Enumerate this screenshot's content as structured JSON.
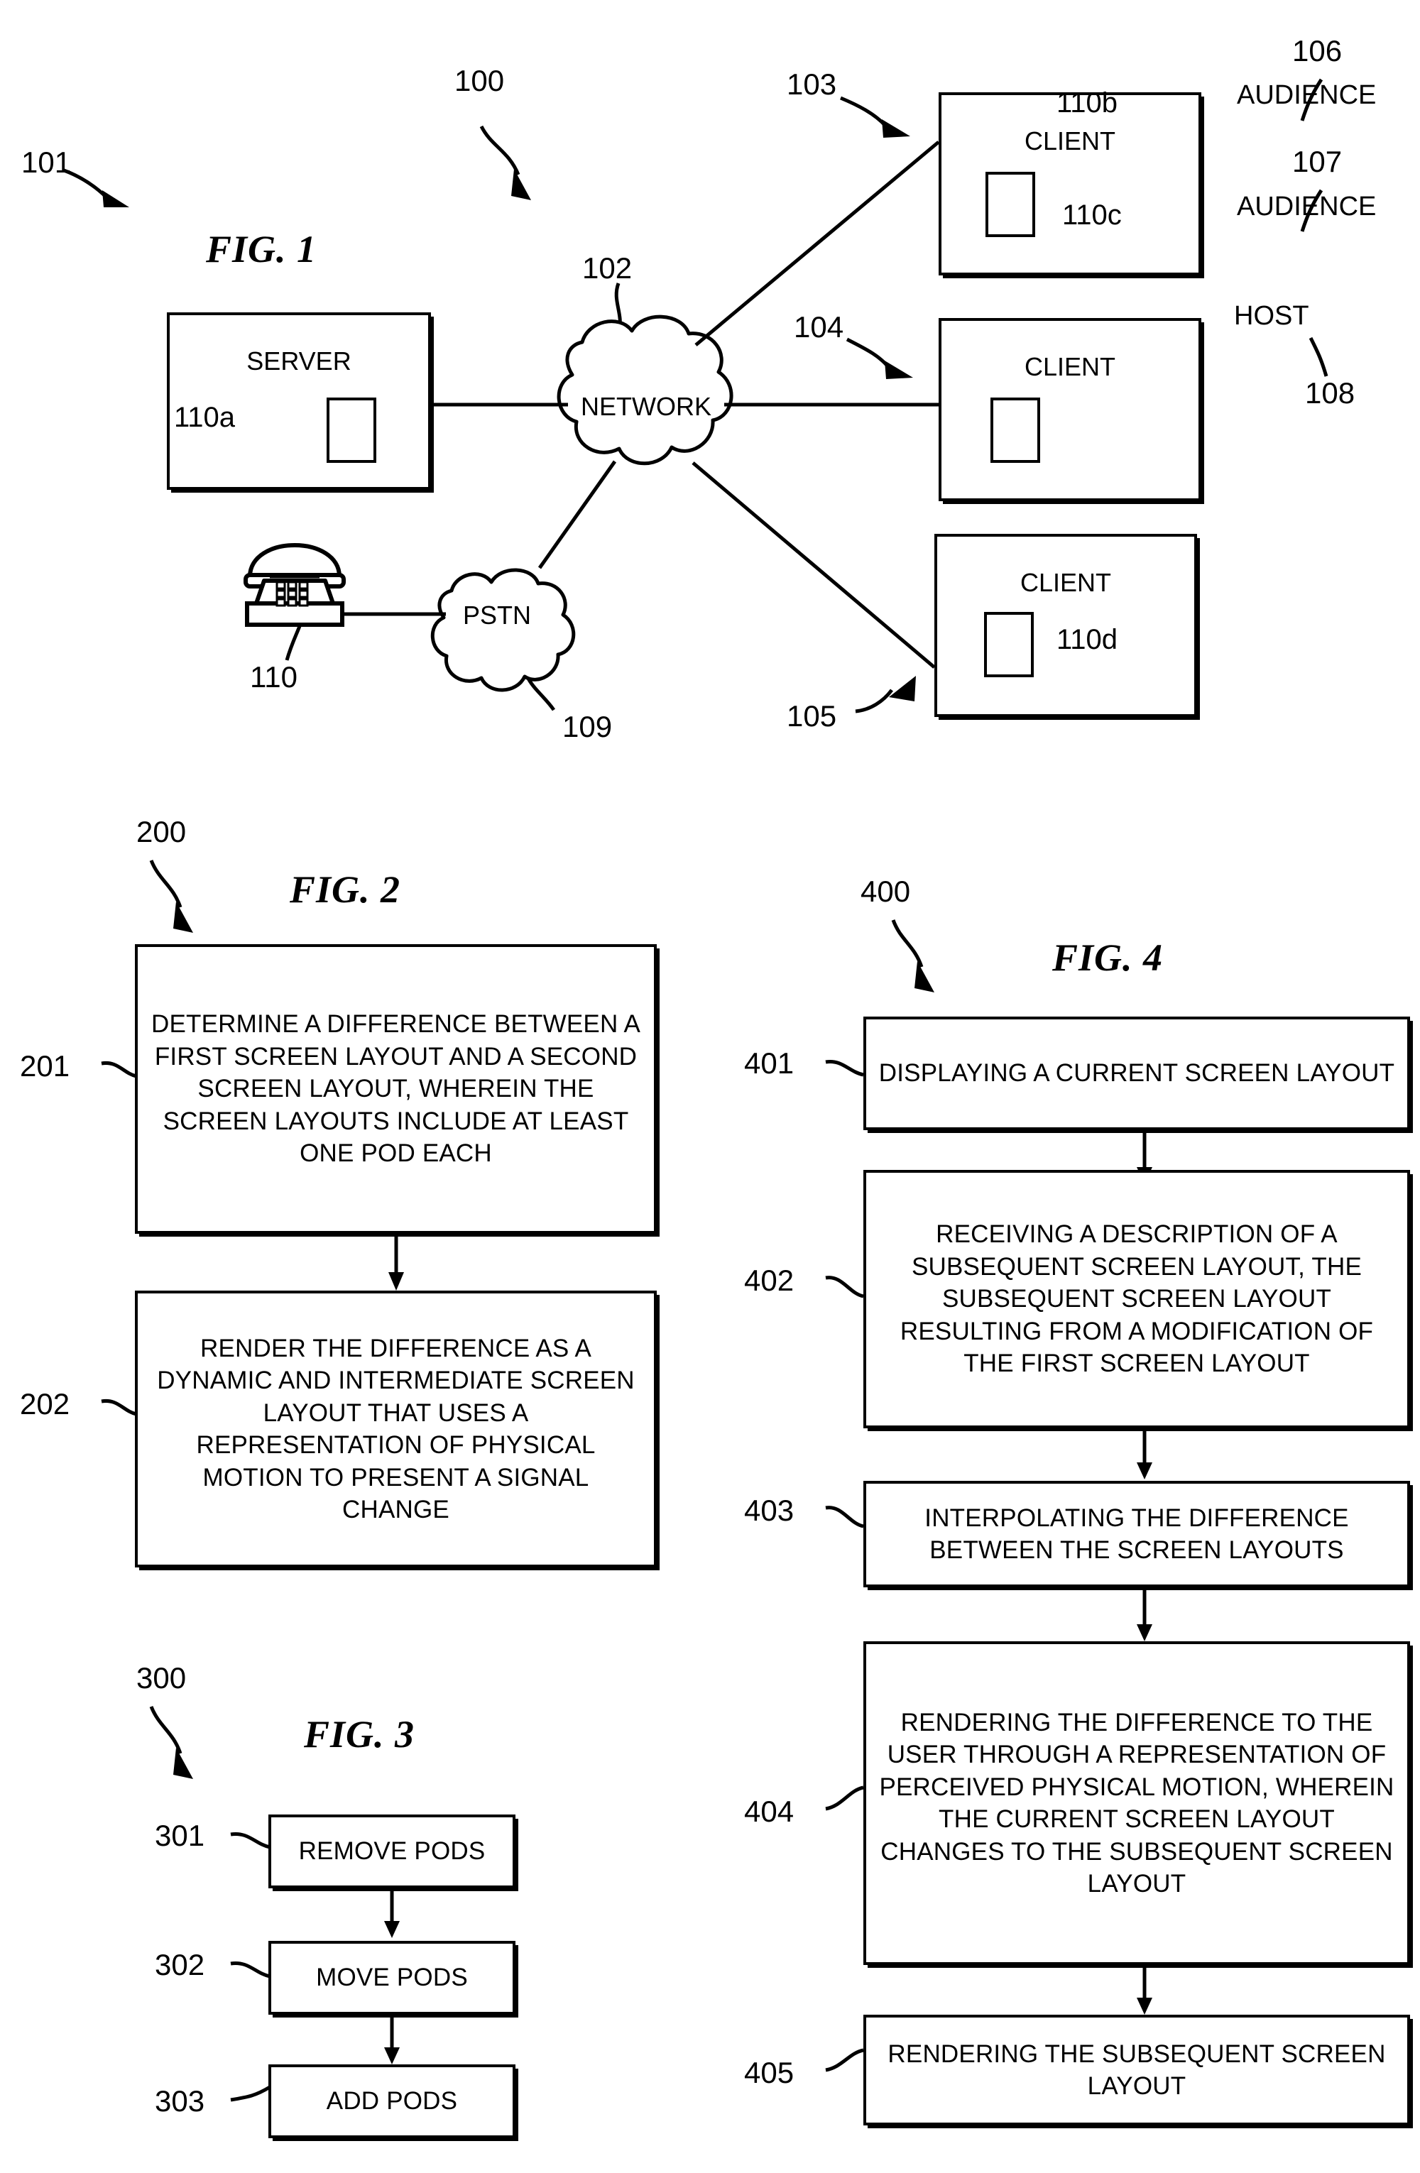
{
  "document": {
    "kind": "patent-drawing-sheet",
    "figures": [
      "FIG. 1",
      "FIG. 2",
      "FIG. 3",
      "FIG. 4"
    ]
  },
  "fig1": {
    "title": "FIG. 1",
    "system_ref": "100",
    "nodes": {
      "server": {
        "ref": "101",
        "label": "SERVER",
        "pod_tag": "110a"
      },
      "network": {
        "ref": "102",
        "label": "NETWORK"
      },
      "pstn": {
        "ref": "109",
        "label": "PSTN"
      },
      "telephone": {
        "ref": "110"
      },
      "client_top": {
        "ref": "103",
        "label": "CLIENT",
        "pod_tag": "110b",
        "role": "AUDIENCE",
        "role_ref": "106"
      },
      "client_mid": {
        "ref": "104",
        "label": "CLIENT",
        "pod_tag": "110c",
        "role": "AUDIENCE",
        "role_ref": "107"
      },
      "client_bottom": {
        "ref": "105",
        "label": "CLIENT",
        "pod_tag": "110d",
        "role": "HOST",
        "role_ref": "108"
      }
    }
  },
  "fig2": {
    "title": "FIG. 2",
    "flow_ref": "200",
    "steps": [
      {
        "ref": "201",
        "text": "DETERMINE A DIFFERENCE BETWEEN A FIRST SCREEN LAYOUT AND A SECOND SCREEN LAYOUT, WHEREIN THE SCREEN LAYOUTS INCLUDE AT LEAST ONE POD EACH"
      },
      {
        "ref": "202",
        "text": "RENDER THE DIFFERENCE AS A DYNAMIC AND INTERMEDIATE SCREEN LAYOUT THAT USES A REPRESENTATION OF PHYSICAL MOTION TO PRESENT A SIGNAL CHANGE"
      }
    ]
  },
  "fig3": {
    "title": "FIG. 3",
    "flow_ref": "300",
    "steps": [
      {
        "ref": "301",
        "text": "REMOVE PODS"
      },
      {
        "ref": "302",
        "text": "MOVE PODS"
      },
      {
        "ref": "303",
        "text": "ADD PODS"
      }
    ]
  },
  "fig4": {
    "title": "FIG. 4",
    "flow_ref": "400",
    "steps": [
      {
        "ref": "401",
        "text": "DISPLAYING A CURRENT SCREEN LAYOUT"
      },
      {
        "ref": "402",
        "text": "RECEIVING A DESCRIPTION OF A SUBSEQUENT SCREEN LAYOUT, THE SUBSEQUENT SCREEN LAYOUT RESULTING FROM A MODIFICATION OF THE FIRST SCREEN LAYOUT"
      },
      {
        "ref": "403",
        "text": "INTERPOLATING THE DIFFERENCE BETWEEN THE SCREEN LAYOUTS"
      },
      {
        "ref": "404",
        "text": "RENDERING THE DIFFERENCE TO THE USER THROUGH A REPRESENTATION OF PERCEIVED PHYSICAL MOTION, WHEREIN THE CURRENT SCREEN LAYOUT CHANGES TO THE SUBSEQUENT SCREEN LAYOUT"
      },
      {
        "ref": "405",
        "text": "RENDERING THE SUBSEQUENT SCREEN LAYOUT"
      }
    ]
  },
  "colors": {
    "ink": "#000000",
    "paper": "#ffffff"
  }
}
